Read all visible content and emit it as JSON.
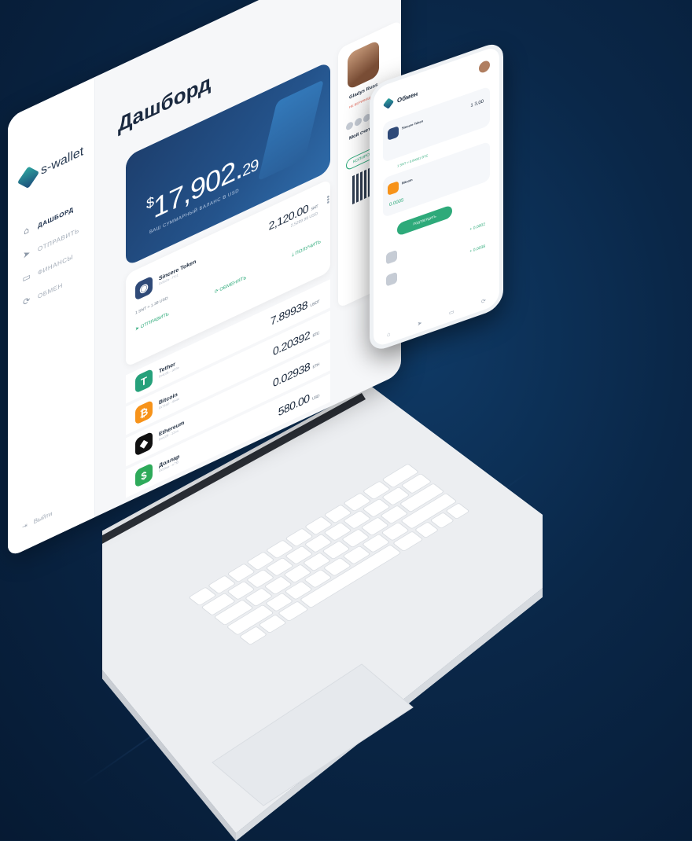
{
  "app": {
    "logo_text": "s-wallet",
    "page_title": "Дашборд"
  },
  "sidebar": {
    "items": [
      {
        "label": "ДАШБОРД",
        "icon": "home-icon",
        "active": true
      },
      {
        "label": "ОТПРАВИТЬ",
        "icon": "send-icon",
        "active": false
      },
      {
        "label": "ФИНАНСЫ",
        "icon": "wallet-icon",
        "active": false
      },
      {
        "label": "ОБМЕН",
        "icon": "exchange-icon",
        "active": false
      }
    ],
    "logout_label": "Выйти"
  },
  "balance": {
    "currency_symbol": "$",
    "integer": "17,902",
    "decimals": "29",
    "label": "ВАШ СУММАРНЫЙ БАЛАНС В USD"
  },
  "token": {
    "name": "Sincere Token",
    "amount": "2,120.00",
    "unit": "SNT",
    "sub_amount": "2,5299.99 USD",
    "rate": "1 SNT = 1.39 USD",
    "send_label": "ОТПРАВИТЬ",
    "exchange_label": "ОБМЕНЯТЬ",
    "receive_label": "ПОЛУЧИТЬ"
  },
  "assets": [
    {
      "name": "Tether",
      "amount": "7.89938",
      "unit": "USDT",
      "color": "#26a17b",
      "glyph": "T"
    },
    {
      "name": "Bitcoin",
      "amount": "0.20392",
      "unit": "BTC",
      "color": "#f7931a",
      "glyph": "₿"
    },
    {
      "name": "Ethereum",
      "amount": "0.02938",
      "unit": "ETH",
      "color": "#111111",
      "glyph": "◆"
    },
    {
      "name": "Доллар",
      "amount": "580.00",
      "unit": "USD",
      "color": "#2eaa5a",
      "glyph": "$"
    }
  ],
  "profile": {
    "name": "Gladys Russ",
    "status": "НЕ ВЕРИФИЦИРОВАН",
    "account_title": "Мой счет Bit",
    "copy_label": "КОПИРОВАТЬ"
  },
  "phone": {
    "title": "Обмен",
    "from_coin": "Sincere Token",
    "from_amount": "1 3,00",
    "rate": "1 SNT = 0.00001 BTC",
    "to_coin": "Bitcoin",
    "to_amount": "0.0005",
    "confirm_label": "ПОДТВЕРДИТЬ",
    "history_1": "+ 0.0002",
    "history_2": "+ 0.0038"
  },
  "colors": {
    "accent": "#2eaa7a",
    "card": "#1d3f6e",
    "background": "#0a2748"
  }
}
